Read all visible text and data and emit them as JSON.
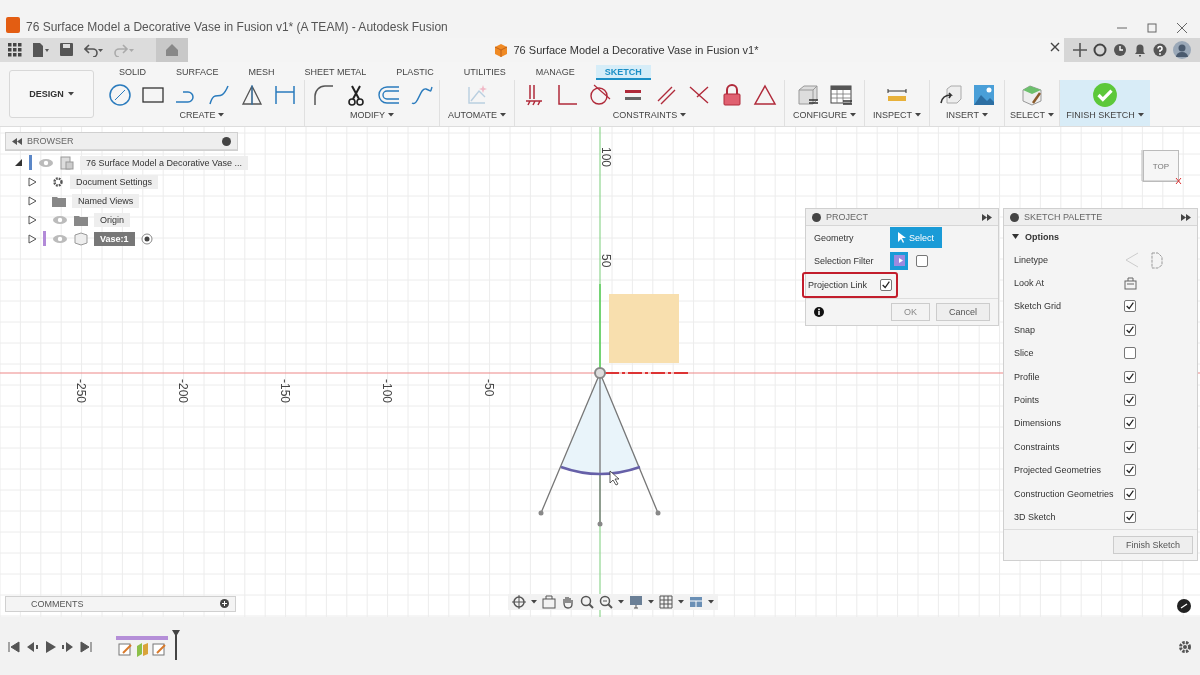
{
  "window": {
    "title": "76 Surface Model a Decorative Vase in Fusion v1* (A TEAM) - Autodesk Fusion"
  },
  "document_tab": {
    "title": "76 Surface Model a Decorative Vase in Fusion v1*"
  },
  "ribbon": {
    "workspace": "DESIGN",
    "tabs": [
      {
        "label": "SOLID",
        "selected": false
      },
      {
        "label": "SURFACE",
        "selected": false
      },
      {
        "label": "MESH",
        "selected": false
      },
      {
        "label": "SHEET METAL",
        "selected": false
      },
      {
        "label": "PLASTIC",
        "selected": false
      },
      {
        "label": "UTILITIES",
        "selected": false
      },
      {
        "label": "MANAGE",
        "selected": false
      },
      {
        "label": "SKETCH",
        "selected": true
      }
    ],
    "groups": [
      {
        "label": "CREATE"
      },
      {
        "label": "MODIFY"
      },
      {
        "label": "AUTOMATE"
      },
      {
        "label": "CONSTRAINTS"
      },
      {
        "label": "CONFIGURE"
      },
      {
        "label": "INSPECT"
      },
      {
        "label": "INSERT"
      },
      {
        "label": "SELECT"
      },
      {
        "label": "FINISH SKETCH"
      }
    ]
  },
  "browser": {
    "title": "BROWSER",
    "root": {
      "label": "76 Surface Model a Decorative Vase ...",
      "expanded": true,
      "children": [
        {
          "label": "Document Settings",
          "kind": "settings",
          "eye": false,
          "selected": false
        },
        {
          "label": "Named Views",
          "kind": "folder",
          "eye": false,
          "selected": false
        },
        {
          "label": "Origin",
          "kind": "folder",
          "eye": true,
          "selected": false
        },
        {
          "label": "Vase:1",
          "kind": "component",
          "eye": true,
          "selected": true
        }
      ]
    }
  },
  "canvas": {
    "axis_labels": {
      "vertical": [
        "100",
        "50"
      ],
      "horizontal": [
        "-250",
        "-200",
        "-150",
        "-100",
        "-50"
      ]
    },
    "view_cube": "TOP"
  },
  "project_dialog": {
    "title": "PROJECT",
    "geometry": {
      "label": "Geometry",
      "button": "Select"
    },
    "selection_filter": {
      "label": "Selection Filter",
      "checked": false
    },
    "projection_link": {
      "label": "Projection Link",
      "checked": true,
      "highlighted": true
    },
    "ok": {
      "label": "OK",
      "disabled": true
    },
    "cancel": "Cancel"
  },
  "sketch_palette": {
    "title": "SKETCH PALETTE",
    "section": "Options",
    "expanded": true,
    "tools": [
      {
        "label": "Linetype",
        "kind": "linetype"
      },
      {
        "label": "Look At",
        "kind": "look_at"
      }
    ],
    "toggles": [
      {
        "label": "Sketch Grid",
        "checked": true
      },
      {
        "label": "Snap",
        "checked": true
      },
      {
        "label": "Slice",
        "checked": false
      },
      {
        "label": "Profile",
        "checked": true
      },
      {
        "label": "Points",
        "checked": true
      },
      {
        "label": "Dimensions",
        "checked": true
      },
      {
        "label": "Constraints",
        "checked": true
      },
      {
        "label": "Projected Geometries",
        "checked": true
      },
      {
        "label": "Construction Geometries",
        "checked": true
      },
      {
        "label": "3D Sketch",
        "checked": true
      }
    ],
    "finish_button": "Finish Sketch"
  },
  "comments": {
    "title": "COMMENTS"
  }
}
